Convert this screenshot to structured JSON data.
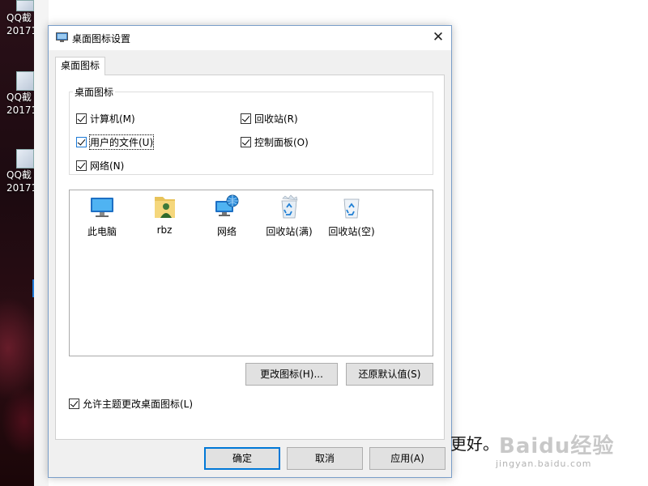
{
  "desktop": {
    "icons": [
      {
        "label": "QQ截",
        "sub": "20171"
      },
      {
        "label": "QQ截",
        "sub": "20171"
      },
      {
        "label": "QQ截",
        "sub": "20171"
      }
    ]
  },
  "dialog": {
    "title": "桌面图标设置",
    "close_glyph": "✕",
    "tab_label": "桌面图标",
    "group_label": "桌面图标",
    "checkboxes": [
      {
        "label": "计算机(M)",
        "checked": true
      },
      {
        "label": "回收站(R)",
        "checked": true
      },
      {
        "label": "用户的文件(U)",
        "checked": true
      },
      {
        "label": "控制面板(O)",
        "checked": true
      },
      {
        "label": "网络(N)",
        "checked": true
      }
    ],
    "icons": [
      {
        "label": "此电脑",
        "icon": "computer-icon"
      },
      {
        "label": "rbz",
        "icon": "user-folder-icon"
      },
      {
        "label": "网络",
        "icon": "network-icon"
      },
      {
        "label": "回收站(满)",
        "icon": "recycle-bin-full-icon"
      },
      {
        "label": "回收站(空)",
        "icon": "recycle-bin-empty-icon"
      }
    ],
    "change_icon_button": "更改图标(H)...",
    "restore_default_button": "还原默认值(S)",
    "allow_theme_checkbox": {
      "label": "允许主题更改桌面图标(L)",
      "checked": true
    },
    "ok_button": "确定",
    "cancel_button": "取消",
    "apply_button": "应用(A)"
  },
  "background_text": "更好。",
  "watermark": {
    "logo": "Baidu经验",
    "url": "jingyan.baidu.com"
  },
  "colors": {
    "accent": "#0078d7",
    "dialog_bg": "#f0f0f0",
    "button_bg": "#e1e1e1"
  }
}
